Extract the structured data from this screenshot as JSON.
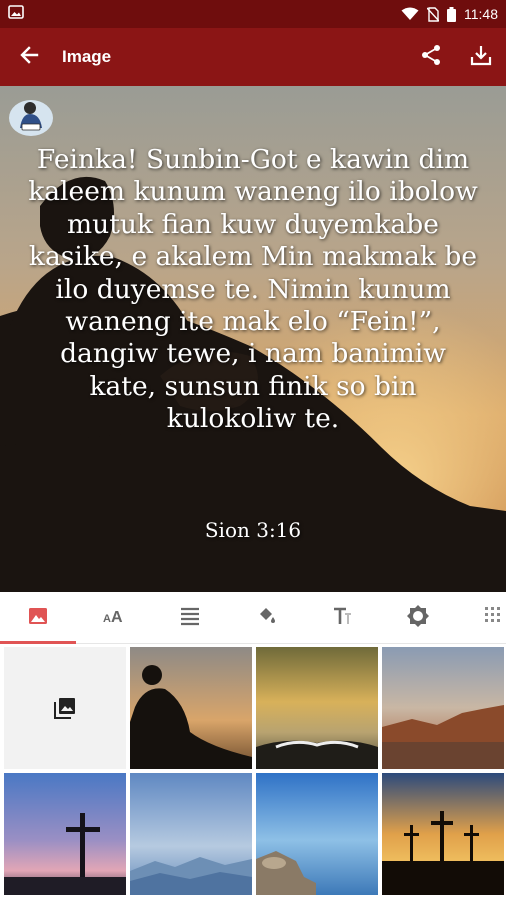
{
  "status_bar": {
    "time": "11:48",
    "icons": [
      "image-notification-icon",
      "wifi-icon",
      "no-sim-icon",
      "battery-icon"
    ]
  },
  "app_bar": {
    "title": "Image",
    "back_icon": "arrow-back-icon",
    "actions": [
      "share-icon",
      "download-icon"
    ]
  },
  "preview": {
    "verse": "Feinka! Sunbin-Got e kawin dim kaleem kunum waneng ilo ibolow mutuk fian kuw duyemkabe kasike, e akalem Min makmak be ilo duyemse te. Nimin kunum waneng ite mak elo “Fein!”, dangiw tewe, i nam banimiw kate, sunsun finik so bin kulokoliw te.",
    "reference": "Sion 3:16"
  },
  "toolbar": {
    "tools": [
      {
        "name": "image-icon",
        "active": true
      },
      {
        "name": "text-size-icon",
        "active": false
      },
      {
        "name": "align-icon",
        "active": false
      },
      {
        "name": "fill-color-icon",
        "active": false
      },
      {
        "name": "text-style-icon",
        "active": false
      },
      {
        "name": "brightness-icon",
        "active": false
      },
      {
        "name": "grid-icon",
        "active": false
      }
    ],
    "accent_color": "#e05454"
  },
  "gallery": {
    "picker_icon": "photo-library-icon",
    "thumbnails": [
      "reading-silhouette",
      "open-bible-sunset",
      "desert-mountains",
      "cross-purple-sky",
      "misty-mountains-blue",
      "rocky-lake",
      "three-crosses-sunset"
    ]
  },
  "colors": {
    "app_bar": "#8b1515",
    "status_bar": "#6f0d0d"
  }
}
